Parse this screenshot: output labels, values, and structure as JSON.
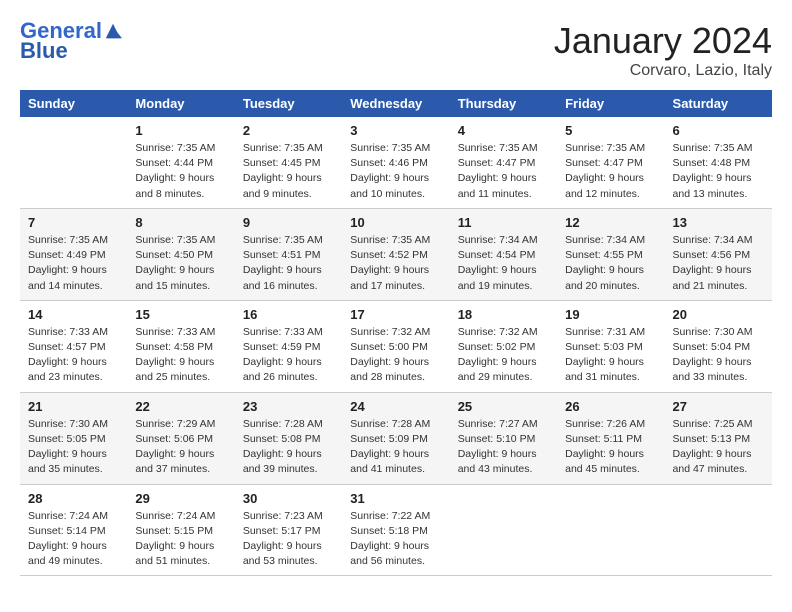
{
  "header": {
    "logo_line1": "General",
    "logo_line2": "Blue",
    "month": "January 2024",
    "location": "Corvaro, Lazio, Italy"
  },
  "weekdays": [
    "Sunday",
    "Monday",
    "Tuesday",
    "Wednesday",
    "Thursday",
    "Friday",
    "Saturday"
  ],
  "weeks": [
    [
      {
        "day": "",
        "info": ""
      },
      {
        "day": "1",
        "info": "Sunrise: 7:35 AM\nSunset: 4:44 PM\nDaylight: 9 hours\nand 8 minutes."
      },
      {
        "day": "2",
        "info": "Sunrise: 7:35 AM\nSunset: 4:45 PM\nDaylight: 9 hours\nand 9 minutes."
      },
      {
        "day": "3",
        "info": "Sunrise: 7:35 AM\nSunset: 4:46 PM\nDaylight: 9 hours\nand 10 minutes."
      },
      {
        "day": "4",
        "info": "Sunrise: 7:35 AM\nSunset: 4:47 PM\nDaylight: 9 hours\nand 11 minutes."
      },
      {
        "day": "5",
        "info": "Sunrise: 7:35 AM\nSunset: 4:47 PM\nDaylight: 9 hours\nand 12 minutes."
      },
      {
        "day": "6",
        "info": "Sunrise: 7:35 AM\nSunset: 4:48 PM\nDaylight: 9 hours\nand 13 minutes."
      }
    ],
    [
      {
        "day": "7",
        "info": "Sunrise: 7:35 AM\nSunset: 4:49 PM\nDaylight: 9 hours\nand 14 minutes."
      },
      {
        "day": "8",
        "info": "Sunrise: 7:35 AM\nSunset: 4:50 PM\nDaylight: 9 hours\nand 15 minutes."
      },
      {
        "day": "9",
        "info": "Sunrise: 7:35 AM\nSunset: 4:51 PM\nDaylight: 9 hours\nand 16 minutes."
      },
      {
        "day": "10",
        "info": "Sunrise: 7:35 AM\nSunset: 4:52 PM\nDaylight: 9 hours\nand 17 minutes."
      },
      {
        "day": "11",
        "info": "Sunrise: 7:34 AM\nSunset: 4:54 PM\nDaylight: 9 hours\nand 19 minutes."
      },
      {
        "day": "12",
        "info": "Sunrise: 7:34 AM\nSunset: 4:55 PM\nDaylight: 9 hours\nand 20 minutes."
      },
      {
        "day": "13",
        "info": "Sunrise: 7:34 AM\nSunset: 4:56 PM\nDaylight: 9 hours\nand 21 minutes."
      }
    ],
    [
      {
        "day": "14",
        "info": "Sunrise: 7:33 AM\nSunset: 4:57 PM\nDaylight: 9 hours\nand 23 minutes."
      },
      {
        "day": "15",
        "info": "Sunrise: 7:33 AM\nSunset: 4:58 PM\nDaylight: 9 hours\nand 25 minutes."
      },
      {
        "day": "16",
        "info": "Sunrise: 7:33 AM\nSunset: 4:59 PM\nDaylight: 9 hours\nand 26 minutes."
      },
      {
        "day": "17",
        "info": "Sunrise: 7:32 AM\nSunset: 5:00 PM\nDaylight: 9 hours\nand 28 minutes."
      },
      {
        "day": "18",
        "info": "Sunrise: 7:32 AM\nSunset: 5:02 PM\nDaylight: 9 hours\nand 29 minutes."
      },
      {
        "day": "19",
        "info": "Sunrise: 7:31 AM\nSunset: 5:03 PM\nDaylight: 9 hours\nand 31 minutes."
      },
      {
        "day": "20",
        "info": "Sunrise: 7:30 AM\nSunset: 5:04 PM\nDaylight: 9 hours\nand 33 minutes."
      }
    ],
    [
      {
        "day": "21",
        "info": "Sunrise: 7:30 AM\nSunset: 5:05 PM\nDaylight: 9 hours\nand 35 minutes."
      },
      {
        "day": "22",
        "info": "Sunrise: 7:29 AM\nSunset: 5:06 PM\nDaylight: 9 hours\nand 37 minutes."
      },
      {
        "day": "23",
        "info": "Sunrise: 7:28 AM\nSunset: 5:08 PM\nDaylight: 9 hours\nand 39 minutes."
      },
      {
        "day": "24",
        "info": "Sunrise: 7:28 AM\nSunset: 5:09 PM\nDaylight: 9 hours\nand 41 minutes."
      },
      {
        "day": "25",
        "info": "Sunrise: 7:27 AM\nSunset: 5:10 PM\nDaylight: 9 hours\nand 43 minutes."
      },
      {
        "day": "26",
        "info": "Sunrise: 7:26 AM\nSunset: 5:11 PM\nDaylight: 9 hours\nand 45 minutes."
      },
      {
        "day": "27",
        "info": "Sunrise: 7:25 AM\nSunset: 5:13 PM\nDaylight: 9 hours\nand 47 minutes."
      }
    ],
    [
      {
        "day": "28",
        "info": "Sunrise: 7:24 AM\nSunset: 5:14 PM\nDaylight: 9 hours\nand 49 minutes."
      },
      {
        "day": "29",
        "info": "Sunrise: 7:24 AM\nSunset: 5:15 PM\nDaylight: 9 hours\nand 51 minutes."
      },
      {
        "day": "30",
        "info": "Sunrise: 7:23 AM\nSunset: 5:17 PM\nDaylight: 9 hours\nand 53 minutes."
      },
      {
        "day": "31",
        "info": "Sunrise: 7:22 AM\nSunset: 5:18 PM\nDaylight: 9 hours\nand 56 minutes."
      },
      {
        "day": "",
        "info": ""
      },
      {
        "day": "",
        "info": ""
      },
      {
        "day": "",
        "info": ""
      }
    ]
  ]
}
